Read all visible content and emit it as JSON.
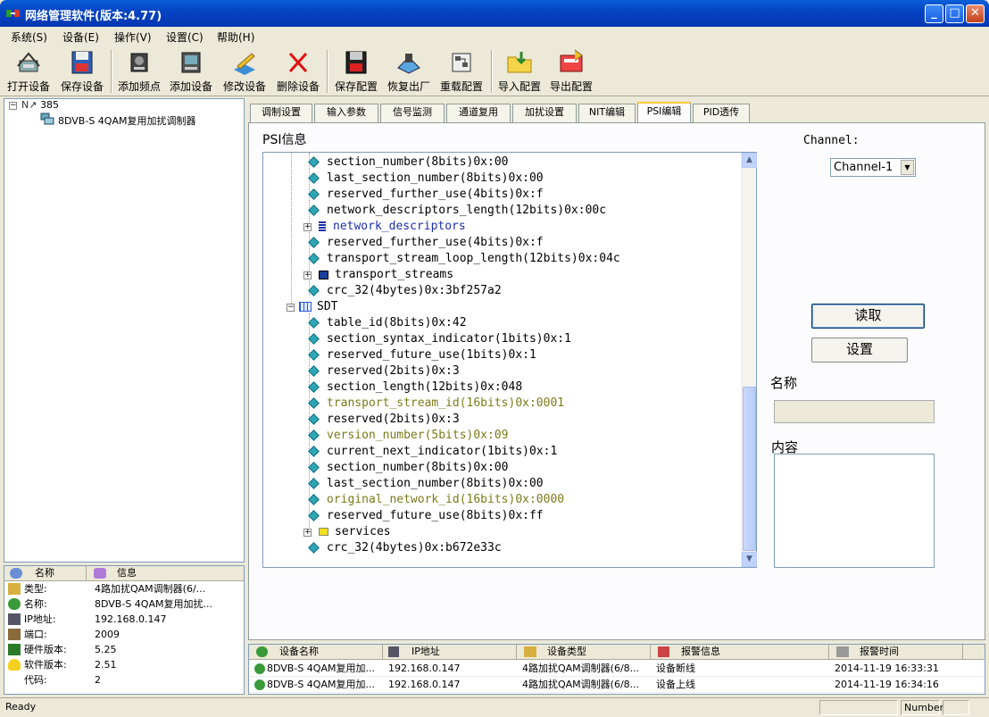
{
  "window": {
    "title": "网络管理软件(版本:4.77)"
  },
  "menu": [
    "系统(S)",
    "设备(E)",
    "操作(V)",
    "设置(C)",
    "帮助(H)"
  ],
  "toolbar": [
    "打开设备",
    "保存设备",
    "添加频点",
    "添加设备",
    "修改设备",
    "删除设备",
    "保存配置",
    "恢复出厂",
    "重载配置",
    "导入配置",
    "导出配置"
  ],
  "tree": {
    "root": "385",
    "child": "8DVB-S 4QAM复用加扰调制器"
  },
  "info": {
    "headers": [
      "名称",
      "信息"
    ],
    "rows": [
      {
        "key": "类型:",
        "value": "4路加扰QAM调制器(6/..."
      },
      {
        "key": "名称:",
        "value": "8DVB-S 4QAM复用加扰..."
      },
      {
        "key": "IP地址:",
        "value": "192.168.0.147"
      },
      {
        "key": "端口:",
        "value": "2009"
      },
      {
        "key": "硬件版本:",
        "value": "5.25"
      },
      {
        "key": "软件版本:",
        "value": "2.51"
      },
      {
        "key": "代码:",
        "value": "2"
      }
    ]
  },
  "tabs": [
    "调制设置",
    "输入参数",
    "信号监测",
    "通道复用",
    "加扰设置",
    "NIT编辑",
    "PSI编辑",
    "PID透传"
  ],
  "active_tab": "PSI编辑",
  "psi": {
    "label": "PSI信息",
    "nodes": [
      {
        "text": "section_number(8bits)0x:00"
      },
      {
        "text": "last_section_number(8bits)0x:00"
      },
      {
        "text": "reserved_further_use(4bits)0x:f"
      },
      {
        "text": "network_descriptors_length(12bits)0x:00c"
      },
      {
        "text": "network_descriptors"
      },
      {
        "text": "reserved_further_use(4bits)0x:f"
      },
      {
        "text": "transport_stream_loop_length(12bits)0x:04c"
      },
      {
        "text": "transport_streams"
      },
      {
        "text": "crc_32(4bytes)0x:3bf257a2"
      },
      {
        "text": "SDT"
      },
      {
        "text": "table_id(8bits)0x:42"
      },
      {
        "text": "section_syntax_indicator(1bits)0x:1"
      },
      {
        "text": "reserved_future_use(1bits)0x:1"
      },
      {
        "text": "reserved(2bits)0x:3"
      },
      {
        "text": "section_length(12bits)0x:048"
      },
      {
        "text": "transport_stream_id(16bits)0x:0001"
      },
      {
        "text": "reserved(2bits)0x:3"
      },
      {
        "text": "version_number(5bits)0x:09"
      },
      {
        "text": "current_next_indicator(1bits)0x:1"
      },
      {
        "text": "section_number(8bits)0x:00"
      },
      {
        "text": "last_section_number(8bits)0x:00"
      },
      {
        "text": "original_network_id(16bits)0x:0000"
      },
      {
        "text": "reserved_future_use(8bits)0x:ff"
      },
      {
        "text": "services"
      },
      {
        "text": "crc_32(4bytes)0x:b672e33c"
      }
    ]
  },
  "controls": {
    "channel_label": "Channel:",
    "channel_value": "Channel-1",
    "read_button": "读取",
    "set_button": "设置",
    "name_label": "名称",
    "content_label": "内容"
  },
  "alarm": {
    "headers": [
      "设备名称",
      "IP地址",
      "设备类型",
      "报警信息",
      "报警时间"
    ],
    "rows": [
      [
        "8DVB-S 4QAM复用加...",
        "192.168.0.147",
        "4路加扰QAM调制器(6/8...",
        "设备断线",
        "2014-11-19 16:33:31"
      ],
      [
        "8DVB-S 4QAM复用加...",
        "192.168.0.147",
        "4路加扰QAM调制器(6/8...",
        "设备上线",
        "2014-11-19 16:34:16"
      ]
    ]
  },
  "status": {
    "text": "Ready",
    "mode": "Number"
  },
  "colors": {
    "blue_node": "#1c2fa8",
    "olive_node": "#7b7a18",
    "diamond": "#2fa6b5"
  }
}
